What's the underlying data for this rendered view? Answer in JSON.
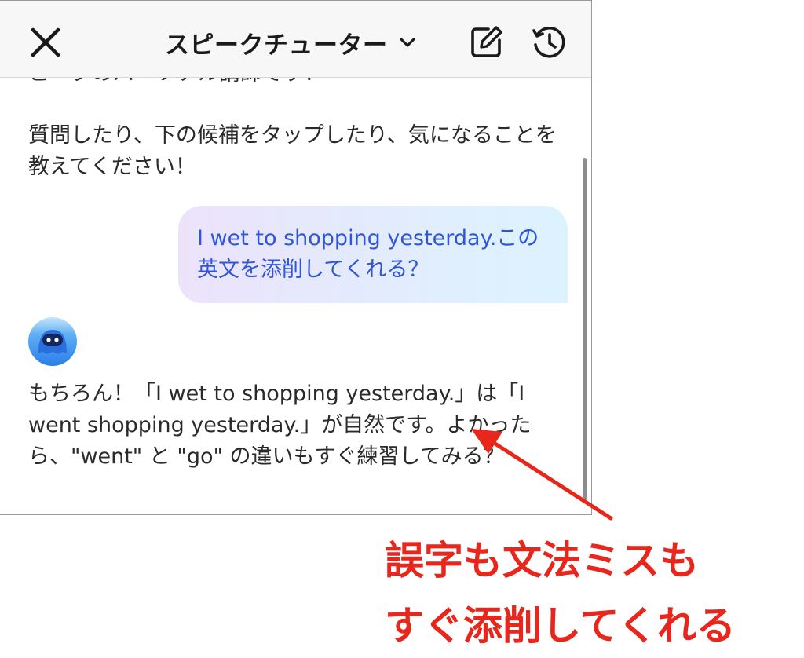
{
  "header": {
    "title": "スピークチューター",
    "icons": {
      "close": "close-icon",
      "chevron": "chevron-down-icon",
      "edit": "edit-icon",
      "history": "history-icon"
    }
  },
  "chat": {
    "bot_cut_line": "ピークのパーソナル講師です！",
    "bot_greeting": "質問したり、下の候補をタップしたり、気になることを教えてください！",
    "user_message": "I wet to shopping yesterday.この英文を添削してくれる？",
    "bot_reply": "もちろん！「I wet to shopping yesterday.」は「I went shopping yesterday.」が自然です。よかったら、\"went\" と \"go\" の違いもすぐ練習してみる？"
  },
  "annotation": {
    "line1": "誤字も文法ミスも",
    "line2": "すぐ添削してくれる",
    "color": "#e8261c"
  },
  "colors": {
    "user_text": "#2f55d8",
    "avatar": "#2f8cf0"
  }
}
